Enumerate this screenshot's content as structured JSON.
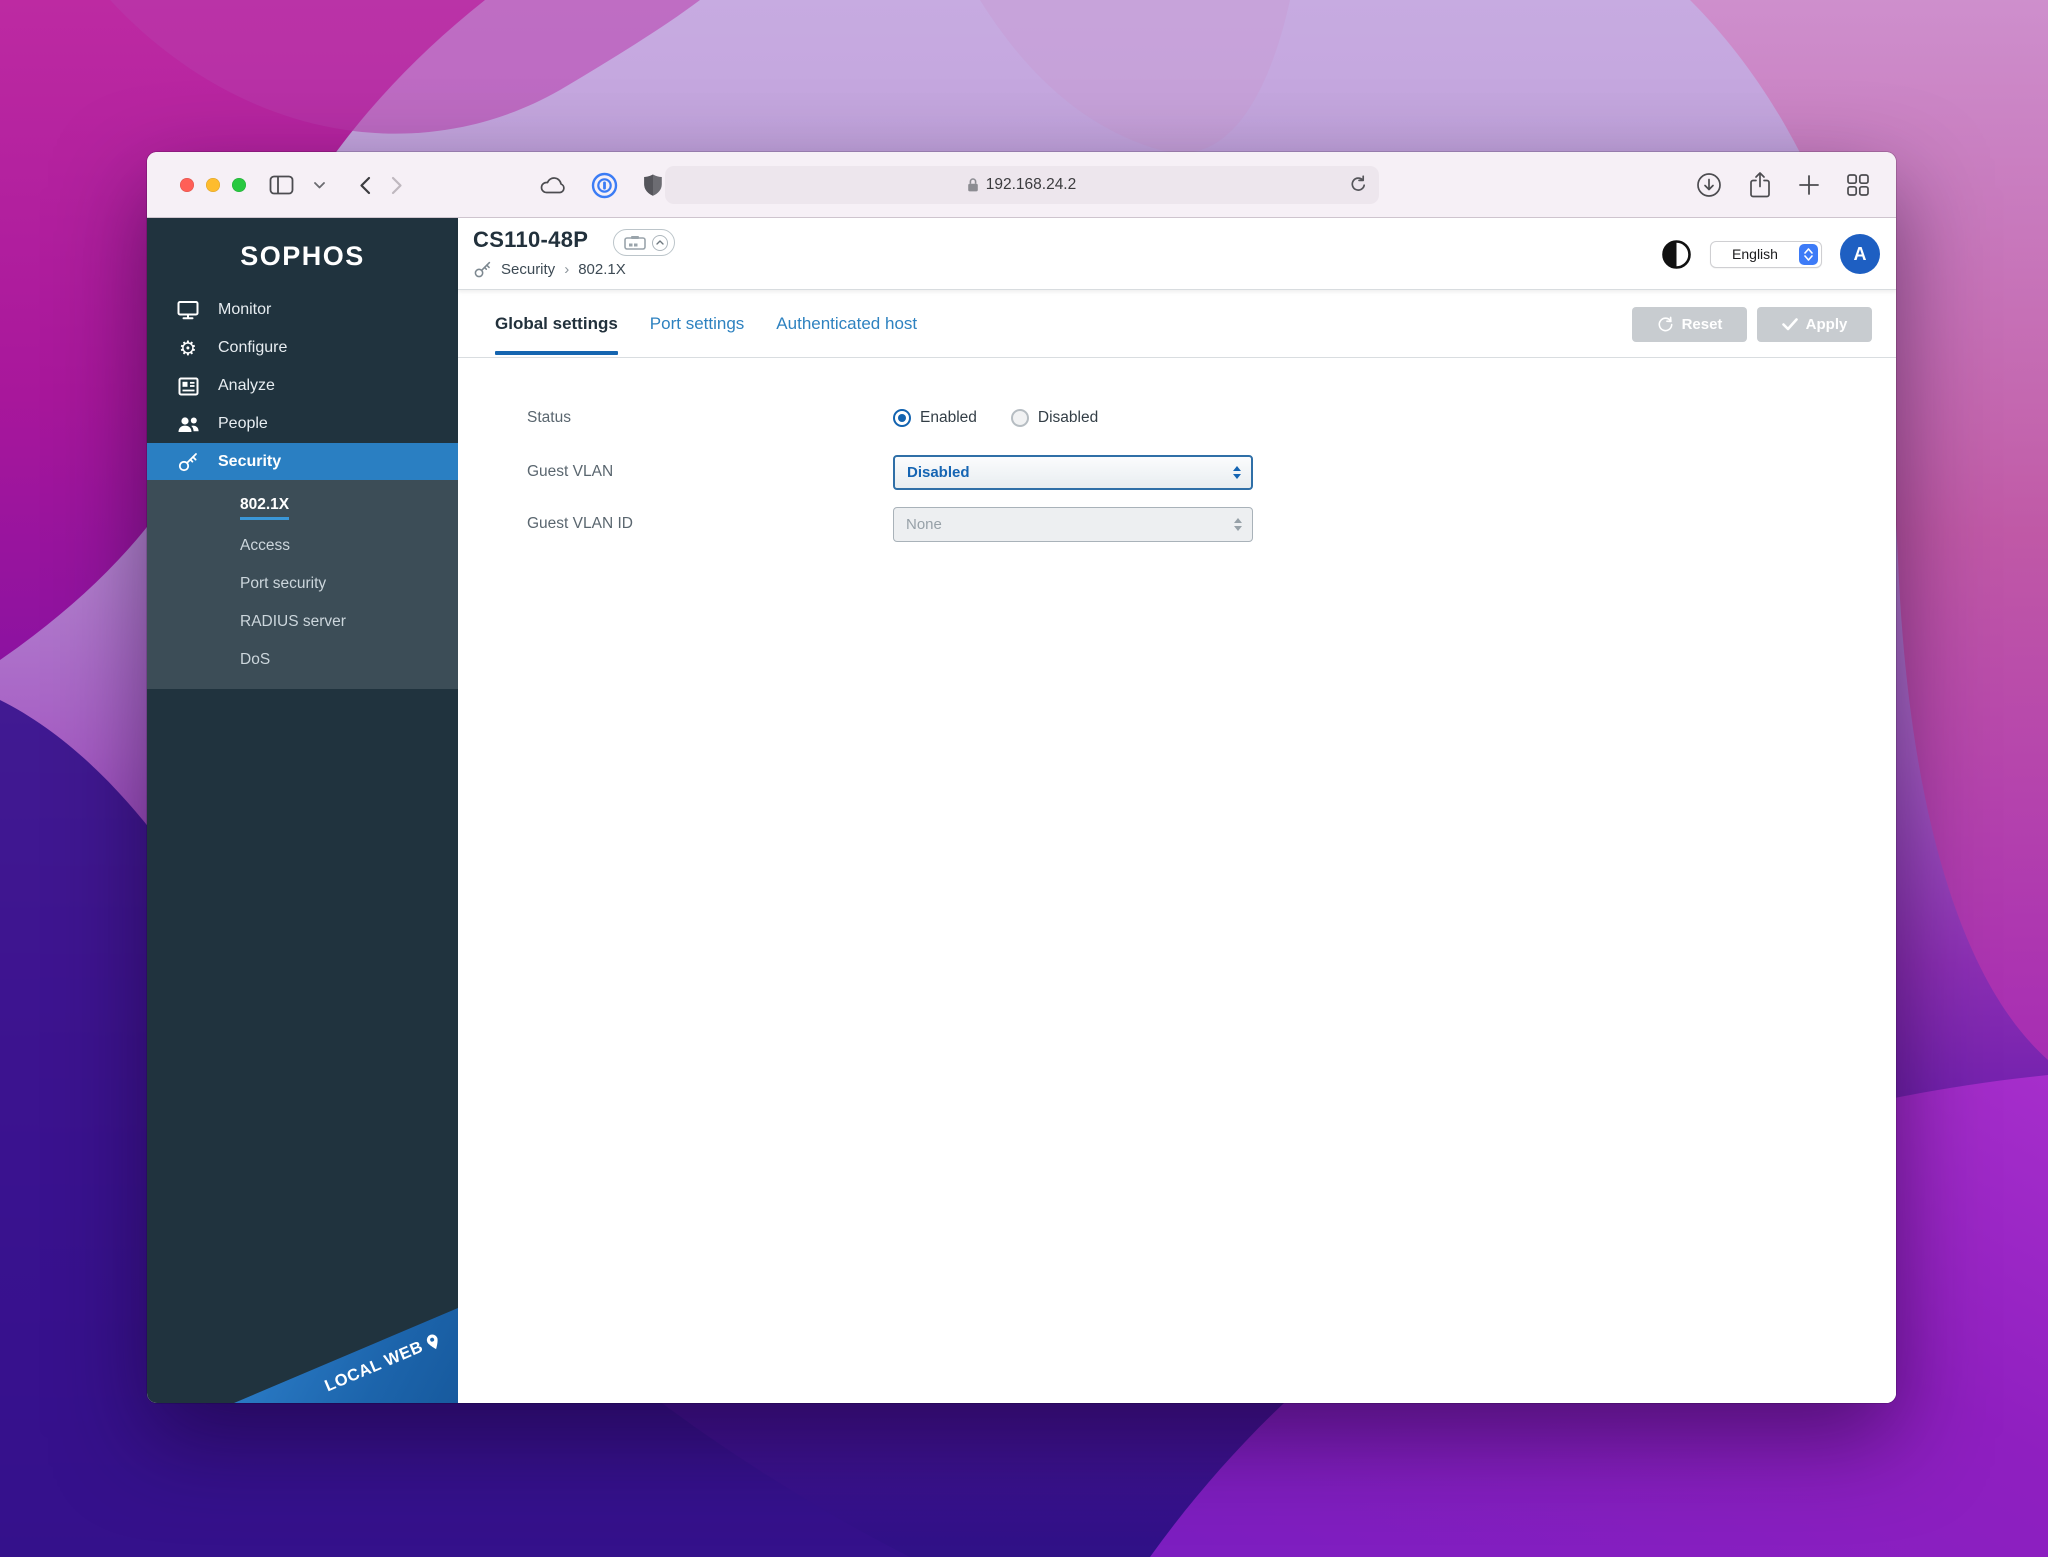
{
  "browser": {
    "url": "192.168.24.2"
  },
  "app": {
    "sidebar": {
      "logo": "SOPHOS",
      "items": [
        {
          "label": "Monitor"
        },
        {
          "label": "Configure"
        },
        {
          "label": "Analyze"
        },
        {
          "label": "People"
        },
        {
          "label": "Security",
          "active": true
        }
      ],
      "subitems": [
        {
          "label": "802.1X",
          "active": true
        },
        {
          "label": "Access"
        },
        {
          "label": "Port security"
        },
        {
          "label": "RADIUS server"
        },
        {
          "label": "DoS"
        }
      ],
      "ribbon_label": "LOCAL WEB"
    },
    "header": {
      "title": "CS110-48P",
      "breadcrumb": [
        "Security",
        "802.1X"
      ],
      "breadcrumb_separator": "›",
      "language": "English",
      "avatar_initial": "A"
    },
    "tabs": [
      {
        "label": "Global settings",
        "active": true
      },
      {
        "label": "Port settings"
      },
      {
        "label": "Authenticated host"
      }
    ],
    "actions": {
      "reset_label": "Reset",
      "apply_label": "Apply"
    },
    "form": {
      "status": {
        "label": "Status",
        "options": [
          "Enabled",
          "Disabled"
        ],
        "selected": "Enabled"
      },
      "guest_vlan": {
        "label": "Guest VLAN",
        "value": "Disabled"
      },
      "guest_vlan_id": {
        "label": "Guest VLAN ID",
        "value": "None",
        "disabled": true
      }
    },
    "colors": {
      "sidebar_bg": "#20333e",
      "sidebar_submenu_bg": "#3c4d57",
      "active_item_bg": "#2a7fc2",
      "tab_underline": "#1565b0",
      "link_blue": "#2e82c0",
      "select_text_blue": "#1565b3",
      "avatar_bg": "#1e5fc2",
      "ribbon_blue": "#1c64ab"
    }
  },
  "icons": {
    "configure_glyph": "⚙"
  }
}
